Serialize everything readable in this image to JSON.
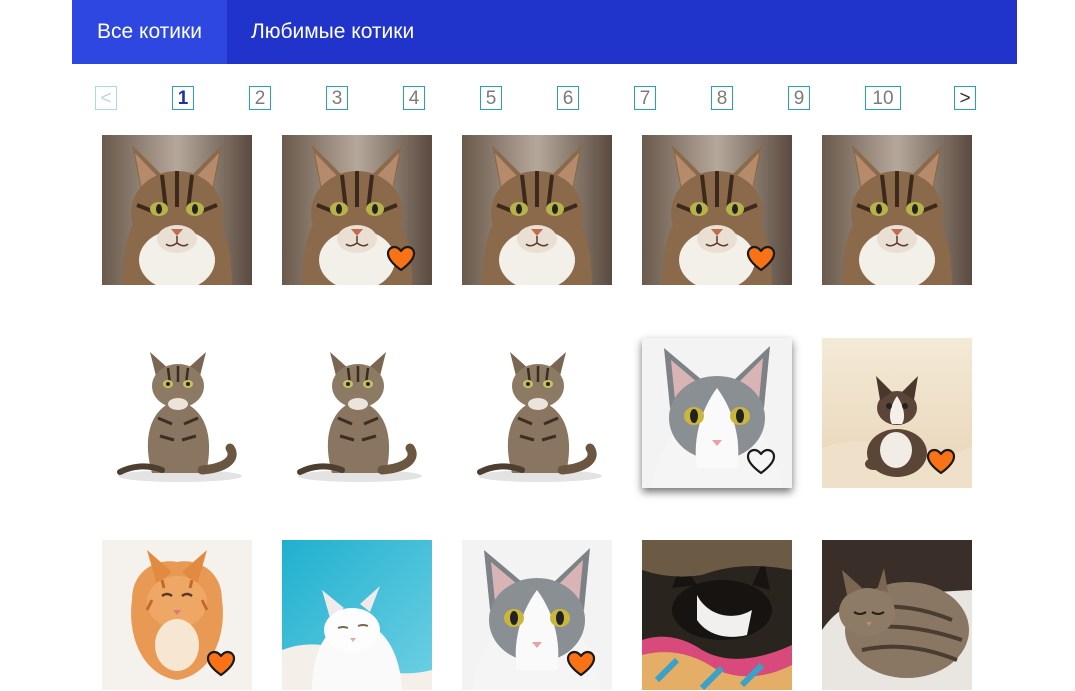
{
  "header": {
    "tabs": [
      {
        "label": "Все котики",
        "active": true
      },
      {
        "label": "Любимые котики",
        "active": false
      }
    ]
  },
  "pagination": {
    "prev": "<",
    "next": ">",
    "pages": [
      "1",
      "2",
      "3",
      "4",
      "5",
      "6",
      "7",
      "8",
      "9",
      "10"
    ],
    "current": "1"
  },
  "colors": {
    "header_bg": "#2034cc",
    "active_tab_bg": "#2d47e0",
    "heart_fill": "#f97316",
    "pager_border": "#2a9fb8"
  },
  "cats": [
    {
      "kind": "tabby-face",
      "favorite": false
    },
    {
      "kind": "tabby-face",
      "favorite": true
    },
    {
      "kind": "tabby-face",
      "favorite": false
    },
    {
      "kind": "tabby-face",
      "favorite": true
    },
    {
      "kind": "tabby-face",
      "favorite": false
    },
    {
      "kind": "tabby-sitting",
      "favorite": false
    },
    {
      "kind": "tabby-sitting",
      "favorite": false
    },
    {
      "kind": "tabby-sitting",
      "favorite": false
    },
    {
      "kind": "gray-white",
      "favorite": false,
      "hovered": true
    },
    {
      "kind": "kitten-bed",
      "favorite": true
    },
    {
      "kind": "ginger-kitten",
      "favorite": true
    },
    {
      "kind": "white-fluffy",
      "favorite": false
    },
    {
      "kind": "gray-white",
      "favorite": true
    },
    {
      "kind": "black-white-blanket",
      "favorite": false
    },
    {
      "kind": "sleeping-tabby",
      "favorite": false
    }
  ]
}
